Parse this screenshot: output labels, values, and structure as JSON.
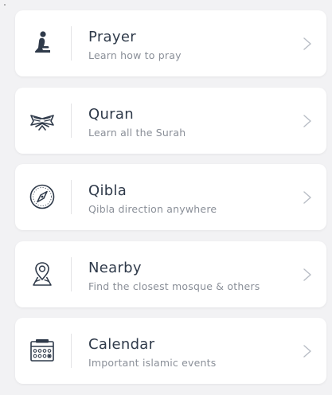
{
  "colors": {
    "background": "#f2f2f4",
    "card": "#ffffff",
    "title": "#2f3a4a",
    "subtitle": "#8a8f98",
    "icon": "#2f3a4a",
    "chevron": "#b7bcc4"
  },
  "menu": {
    "items": [
      {
        "title": "Prayer",
        "subtitle": "Learn how to pray",
        "icon": "praying-person-icon"
      },
      {
        "title": "Quran",
        "subtitle": "Learn all the Surah",
        "icon": "open-quran-icon"
      },
      {
        "title": "Qibla",
        "subtitle": "Qibla direction anywhere",
        "icon": "compass-icon"
      },
      {
        "title": "Nearby",
        "subtitle": "Find the closest mosque & others",
        "icon": "location-pin-icon"
      },
      {
        "title": "Calendar",
        "subtitle": "Important islamic events",
        "icon": "calendar-icon"
      }
    ]
  }
}
